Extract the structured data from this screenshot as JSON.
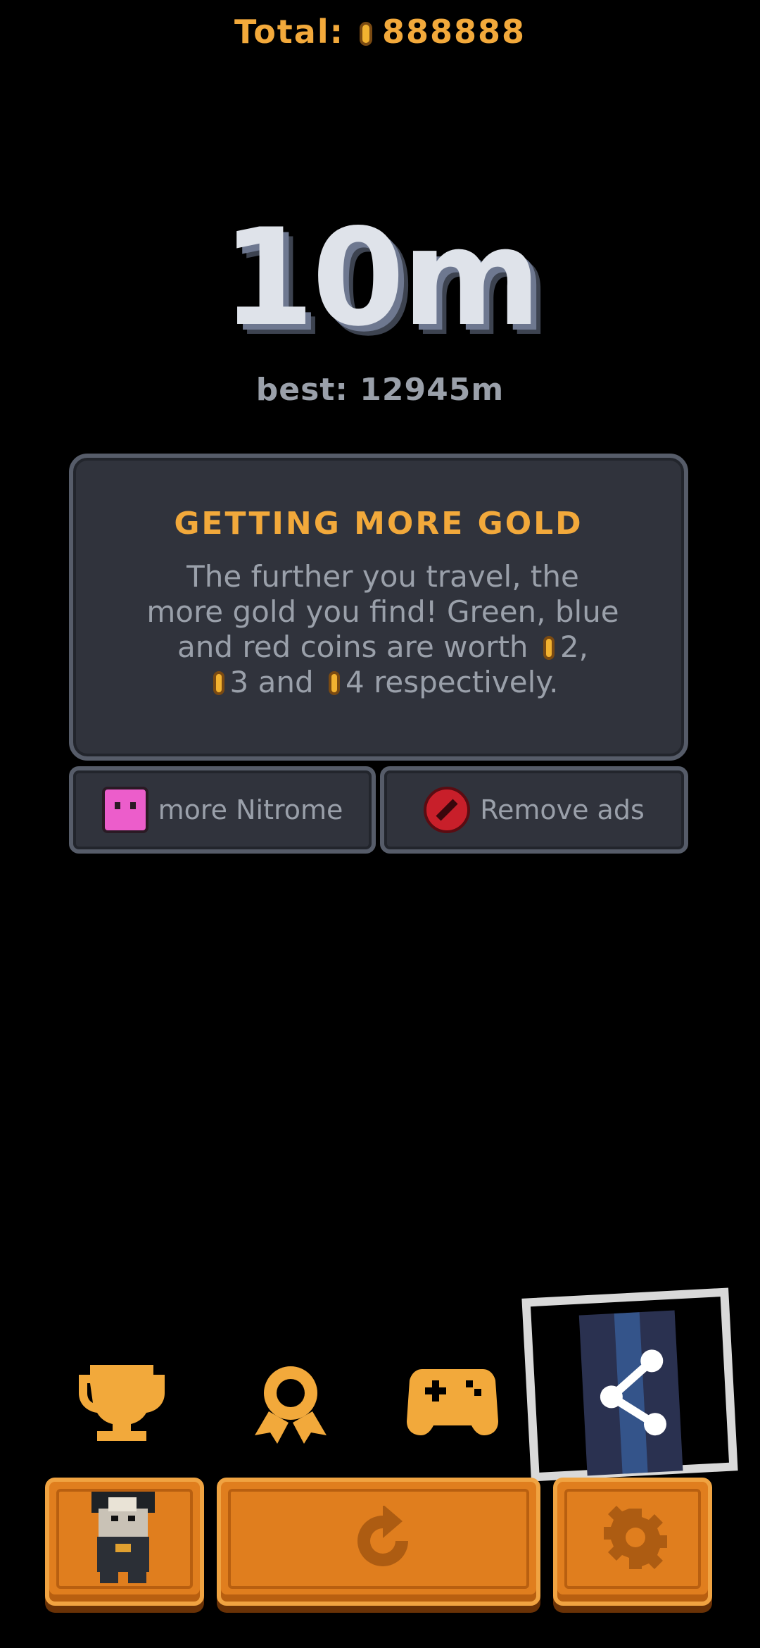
{
  "header": {
    "total_label": "Total:",
    "total_value": "888888"
  },
  "score": {
    "distance": "10m",
    "best": "best: 12945m"
  },
  "tip": {
    "title": "GETTING MORE GOLD",
    "line1": "The further you travel, the",
    "line2": "more gold you find! Green, blue",
    "line3a": "and red coins are worth",
    "line3b": "2,",
    "line4a": "3 and",
    "line4b": "4 respectively."
  },
  "buttons": {
    "more_nitrome": "more Nitrome",
    "remove_ads": "Remove ads"
  },
  "icons": [
    "coin-icon",
    "trophy-icon",
    "badge-icon",
    "gamepad-icon",
    "share-icon",
    "character-icon",
    "restart-icon",
    "settings-icon"
  ],
  "colors": {
    "accent": "#f2a93b",
    "button": "#e07e1e",
    "panel": "#30333c",
    "text_gray": "#9aa0aa"
  }
}
